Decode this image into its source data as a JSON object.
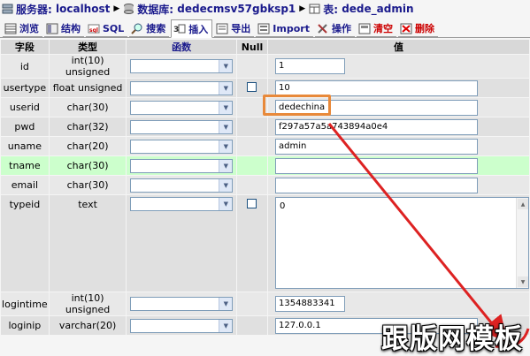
{
  "breadcrumb": {
    "server_label": "服务器:",
    "server": "localhost",
    "db_label": "数据库:",
    "db": "dedecmsv57gbksp1",
    "table_label": "表:",
    "table": "dede_admin"
  },
  "tabs": [
    {
      "label": "浏览",
      "icon": "browse-icon"
    },
    {
      "label": "结构",
      "icon": "structure-icon"
    },
    {
      "label": "SQL",
      "icon": "sql-icon"
    },
    {
      "label": "搜索",
      "icon": "search-icon"
    },
    {
      "label": "插入",
      "icon": "insert-icon"
    },
    {
      "label": "导出",
      "icon": "export-icon"
    },
    {
      "label": "Import",
      "icon": "import-icon"
    },
    {
      "label": "操作",
      "icon": "operations-icon"
    },
    {
      "label": "清空",
      "icon": "empty-icon"
    },
    {
      "label": "删除",
      "icon": "drop-icon"
    }
  ],
  "headers": {
    "field": "字段",
    "type": "类型",
    "function": "函数",
    "null": "Null",
    "value": "值"
  },
  "rows": [
    {
      "field": "id",
      "type": "int(10) unsigned",
      "value": "1"
    },
    {
      "field": "usertype",
      "type": "float unsigned",
      "value": "10"
    },
    {
      "field": "userid",
      "type": "char(30)",
      "value": "dedechina"
    },
    {
      "field": "pwd",
      "type": "char(32)",
      "value": "f297a57a5a743894a0e4"
    },
    {
      "field": "uname",
      "type": "char(20)",
      "value": "admin"
    },
    {
      "field": "tname",
      "type": "char(30)",
      "value": ""
    },
    {
      "field": "email",
      "type": "char(30)",
      "value": ""
    },
    {
      "field": "typeid",
      "type": "text",
      "value": "0"
    },
    {
      "field": "logintime",
      "type": "int(10) unsigned",
      "value": "1354883341"
    },
    {
      "field": "loginip",
      "type": "varchar(20)",
      "value": "127.0.0.1"
    }
  ],
  "watermark": "跟版网模板",
  "colors": {
    "accent": "#1a1a8c",
    "highlight_row": "#ccffcc",
    "annotation_box": "#e8893a",
    "arrow": "#dd2222"
  }
}
